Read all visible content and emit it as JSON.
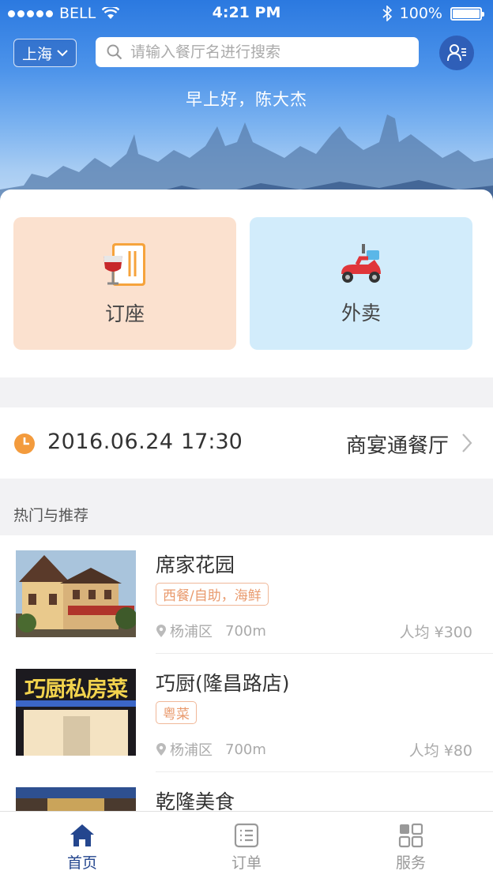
{
  "status_bar": {
    "carrier": "BELL",
    "time": "4:21 PM",
    "battery": "100%",
    "battery_level": 1.0
  },
  "header": {
    "city": "上海",
    "search_placeholder": "请输入餐厅名进行搜索",
    "greeting": "早上好，陈大杰"
  },
  "services": [
    {
      "label": "订座",
      "icon": "menu-wine-icon"
    },
    {
      "label": "外卖",
      "icon": "scooter-icon"
    }
  ],
  "reservation": {
    "date": "2016.06.24",
    "time": "17:30",
    "type": "商宴通餐厅"
  },
  "section_title": "热门与推荐",
  "restaurants": [
    {
      "name": "席家花园",
      "tag": "西餐/自助，海鲜",
      "district": "杨浦区",
      "distance": "700m",
      "price": "人均 ¥300"
    },
    {
      "name": "巧厨(隆昌路店)",
      "tag": "粤菜",
      "district": "杨浦区",
      "distance": "700m",
      "price": "人均 ¥80",
      "sign_text": "巧厨私房菜"
    },
    {
      "name": "乾隆美食"
    }
  ],
  "tabs": [
    {
      "label": "首页",
      "icon": "home-icon",
      "active": true
    },
    {
      "label": "订单",
      "icon": "order-list-icon",
      "active": false
    },
    {
      "label": "服务",
      "icon": "grid-services-icon",
      "active": false
    }
  ],
  "colors": {
    "primary": "#24468e",
    "accent": "#f39b3d",
    "tag": "#e99a6d",
    "dine_tile": "#fbe1cf",
    "delivery_tile": "#d2ecfb"
  }
}
